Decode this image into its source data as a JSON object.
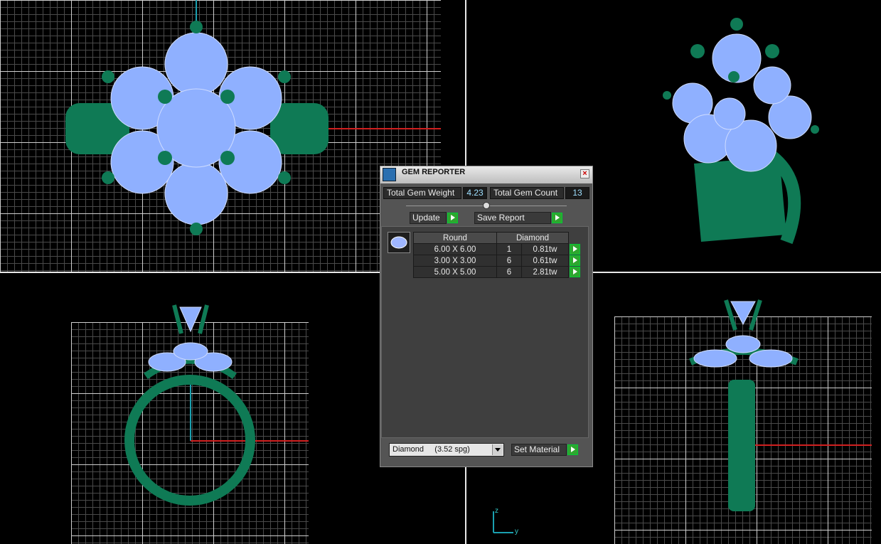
{
  "dialog": {
    "title": "GEM REPORTER",
    "total_weight_label": "Total Gem Weight",
    "total_weight_value": "4.23",
    "total_count_label": "Total Gem Count",
    "total_count_value": "13",
    "update_label": "Update",
    "save_label": "Save Report",
    "table": {
      "headers": [
        "Round",
        "Diamond"
      ],
      "rows": [
        {
          "size": "6.00 X 6.00",
          "count": "1",
          "weight": "0.81tw"
        },
        {
          "size": "3.00 X 3.00",
          "count": "6",
          "weight": "0.61tw"
        },
        {
          "size": "5.00 X 5.00",
          "count": "6",
          "weight": "2.81tw"
        }
      ]
    },
    "material_select": "Diamond     (3.52 spg)",
    "set_material_label": "Set Material"
  },
  "axis": {
    "z": "z",
    "y": "y"
  },
  "colors": {
    "metal": "#0f7a55",
    "gem": "#8fb0ff",
    "grid_major": "#cfcfcf",
    "accent_red": "#d02020",
    "accent_cyan": "#1aa0b0"
  }
}
